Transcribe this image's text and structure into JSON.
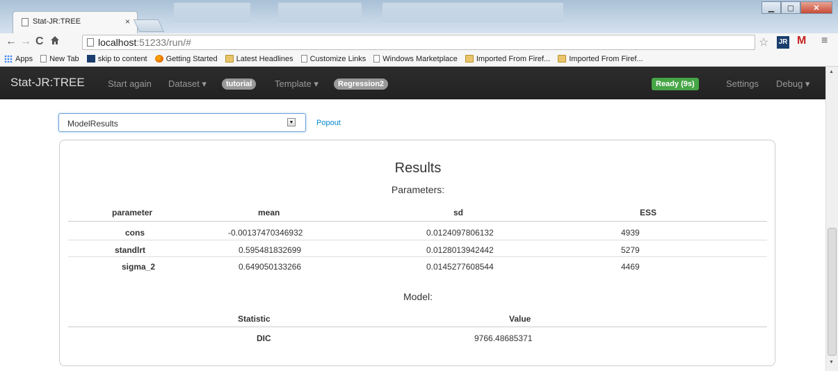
{
  "browser": {
    "tab_title": "Stat-JR:TREE",
    "tab_close": "×",
    "url_host": "localhost",
    "url_rest": ":51233/run/#",
    "bookmarks": [
      {
        "label": "Apps",
        "icon": "apps-icon"
      },
      {
        "label": "New Tab",
        "icon": "page-icon"
      },
      {
        "label": "skip to content",
        "icon": "skip-icon"
      },
      {
        "label": "Getting Started",
        "icon": "firefox-icon"
      },
      {
        "label": "Latest Headlines",
        "icon": "folder-icon"
      },
      {
        "label": "Customize Links",
        "icon": "page-icon"
      },
      {
        "label": "Windows Marketplace",
        "icon": "page-icon"
      },
      {
        "label": "Imported From Firef...",
        "icon": "folder-icon"
      },
      {
        "label": "Imported From Firef...",
        "icon": "folder-icon"
      }
    ]
  },
  "navbar": {
    "brand": "Stat-JR:TREE",
    "start_again": "Start again",
    "dataset": "Dataset ▾",
    "dataset_badge": "tutorial",
    "template": "Template ▾",
    "template_badge": "Regression2",
    "status": "Ready (9s)",
    "settings": "Settings",
    "debug": "Debug ▾"
  },
  "controls": {
    "select_value": "ModelResults",
    "popout": "Popout"
  },
  "results": {
    "title": "Results",
    "parameters_heading": "Parameters:",
    "param_columns": [
      "parameter",
      "mean",
      "sd",
      "ESS"
    ],
    "param_rows": [
      {
        "parameter": "cons",
        "mean": "-0.00137470346932",
        "sd": "0.0124097806132",
        "ess": "4939"
      },
      {
        "parameter": "standlrt",
        "mean": "0.595481832699",
        "sd": "0.0128013942442",
        "ess": "5279"
      },
      {
        "parameter": "sigma_2",
        "mean": "0.649050133266",
        "sd": "0.0145277608544",
        "ess": "4469"
      }
    ],
    "model_heading": "Model:",
    "model_columns": [
      "Statistic",
      "Value"
    ],
    "model_rows": [
      {
        "statistic": "DIC",
        "value": "9766.48685371"
      }
    ]
  },
  "colors": {
    "navbar": "#222222",
    "ready": "#46a546",
    "link": "#0088cc"
  }
}
